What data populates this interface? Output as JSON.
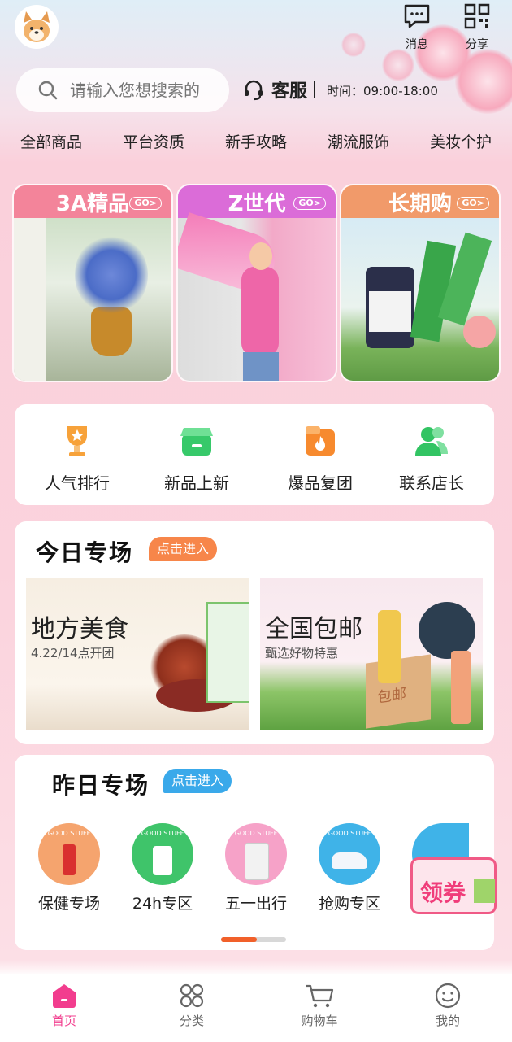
{
  "header": {
    "messages_label": "消息",
    "share_label": "分享"
  },
  "search": {
    "placeholder": "请输入您想搜索的"
  },
  "service": {
    "label": "客服",
    "hours": "时间：09:00-18:00"
  },
  "categories": [
    "全部商品",
    "平台资质",
    "新手攻略",
    "潮流服饰",
    "美妆个护"
  ],
  "feature_cards": [
    {
      "title": "3A精品",
      "go": "GO>",
      "color": "#f3849a"
    },
    {
      "title": "Z世代",
      "go": "GO>",
      "color": "#db6cd8"
    },
    {
      "title": "长期购",
      "go": "GO>",
      "color": "#f19a6a"
    }
  ],
  "quick_entries": [
    {
      "label": "人气排行",
      "icon": "trophy-icon",
      "color": "#f7a23a"
    },
    {
      "label": "新品上新",
      "icon": "store-icon",
      "color": "#37c96a"
    },
    {
      "label": "爆品复团",
      "icon": "fire-box-icon",
      "color": "#f78a2e"
    },
    {
      "label": "联系店长",
      "icon": "contacts-icon",
      "color": "#32c463"
    }
  ],
  "today": {
    "title": "今日专场",
    "enter": "点击进入",
    "banners": [
      {
        "title": "地方美食",
        "subtitle": "4.22/14点开团"
      },
      {
        "title": "全国包邮",
        "subtitle": "甄选好物特惠",
        "box_text": "包邮"
      }
    ]
  },
  "yesterday": {
    "title": "昨日专场",
    "enter": "点击进入",
    "badge_text": "GOOD STUFF",
    "items": [
      {
        "label": "保健专场",
        "color": "#f5a46e"
      },
      {
        "label": "24h专区",
        "color": "#3fc46a"
      },
      {
        "label": "五一出行",
        "color": "#f6a2c8"
      },
      {
        "label": "抢购专区",
        "color": "#3fb3e8"
      }
    ],
    "coupon_label": "领券"
  },
  "tabbar": [
    {
      "label": "首页",
      "icon": "home-icon",
      "active": true
    },
    {
      "label": "分类",
      "icon": "category-icon",
      "active": false
    },
    {
      "label": "购物车",
      "icon": "cart-icon",
      "active": false
    },
    {
      "label": "我的",
      "icon": "profile-icon",
      "active": false
    }
  ],
  "colors": {
    "accent": "#f23d8e",
    "orange_pill": "#f7864a",
    "blue_pill": "#3aa9ea"
  }
}
